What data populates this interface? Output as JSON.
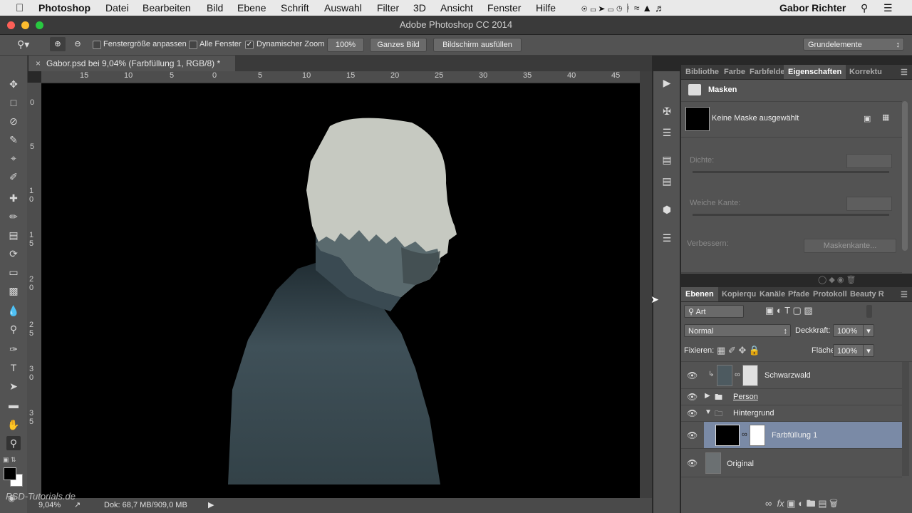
{
  "menubar": {
    "apple_icon": "apple-icon",
    "app_name": "Photoshop",
    "items": [
      "Datei",
      "Bearbeiten",
      "Bild",
      "Ebene",
      "Schrift",
      "Auswahl",
      "Filter",
      "3D",
      "Ansicht",
      "Fenster",
      "Hilfe"
    ],
    "user": "Gabor Richter"
  },
  "window": {
    "title": "Adobe Photoshop CC 2014"
  },
  "options": {
    "fit_window": "Fenstergröße anpassen",
    "all_windows": "Alle Fenster",
    "dynamic_zoom": "Dynamischer Zoom",
    "btn_100": "100%",
    "btn_whole": "Ganzes Bild",
    "btn_fill": "Bildschirm ausfüllen",
    "workspace": "Grundelemente"
  },
  "document": {
    "tab_title": "Gabor.psd bei 9,04% (Farbfüllung 1, RGB/8) *",
    "ruler_h": [
      "15",
      "10",
      "5",
      "0",
      "5",
      "10",
      "15",
      "20",
      "25",
      "30",
      "35",
      "40",
      "45"
    ],
    "ruler_v": [
      "0",
      "5",
      "10",
      "15",
      "20",
      "25",
      "30",
      "35"
    ]
  },
  "status": {
    "zoom": "9,04%",
    "doc": "Dok: 68,7 MB/909,0 MB"
  },
  "watermark": "PSD-Tutorials.de",
  "properties": {
    "tabs": [
      "Bibliothe",
      "Farbe",
      "Farbfelde",
      "Eigenschaften",
      "Korrektu"
    ],
    "header": "Masken",
    "no_mask": "Keine Maske ausgewählt",
    "density_label": "Dichte:",
    "feather_label": "Weiche Kante:",
    "refine_label": "Verbessern:",
    "mask_edge_btn": "Maskenkante..."
  },
  "layers_panel": {
    "tabs": [
      "Ebenen",
      "Kopierqu",
      "Kanäle",
      "Pfade",
      "Protokoll",
      "Beauty R"
    ],
    "filter": "Art",
    "blend_mode": "Normal",
    "opacity_label": "Deckkraft:",
    "opacity": "100%",
    "lock_label": "Fixieren:",
    "fill_label": "Fläche:",
    "fill": "100%",
    "layers": [
      {
        "name": "Schwarzwald"
      },
      {
        "name": "Person"
      },
      {
        "name": "Hintergrund"
      },
      {
        "name": "Farbfüllung 1"
      },
      {
        "name": "Original"
      }
    ]
  },
  "colors": {
    "selected_layer": "#7a8aa6",
    "canvas": "#000000"
  }
}
